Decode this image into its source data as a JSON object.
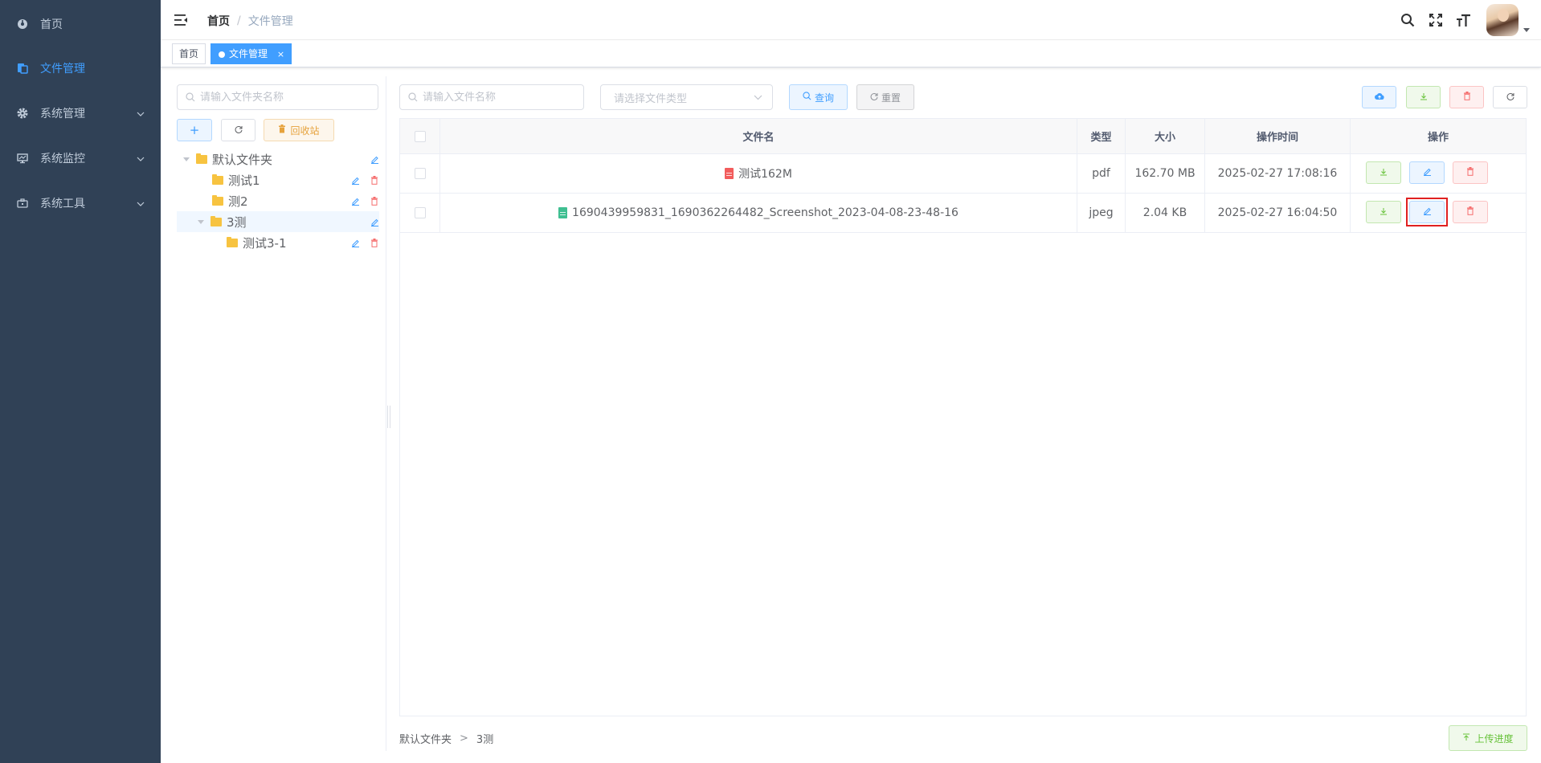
{
  "sidebar": {
    "items": [
      {
        "label": "首页",
        "icon": "dashboard-icon",
        "active": false
      },
      {
        "label": "文件管理",
        "icon": "files-icon",
        "active": true
      },
      {
        "label": "系统管理",
        "icon": "gear-icon",
        "active": false
      },
      {
        "label": "系统监控",
        "icon": "monitor-icon",
        "active": false
      },
      {
        "label": "系统工具",
        "icon": "toolbox-icon",
        "active": false
      }
    ]
  },
  "navbar": {
    "breadcrumb": {
      "home": "首页",
      "separator": "/",
      "current": "文件管理"
    }
  },
  "tags": [
    {
      "label": "首页"
    },
    {
      "label": "文件管理",
      "close": "×"
    }
  ],
  "tree": {
    "search_placeholder": "请输入文件夹名称",
    "add_label": "+",
    "recycle_label": "回收站",
    "nodes": [
      {
        "label": "默认文件夹"
      },
      {
        "label": "测试1"
      },
      {
        "label": "测2"
      },
      {
        "label": "3测"
      },
      {
        "label": "测试3-1"
      }
    ]
  },
  "toolbar": {
    "filename_placeholder": "请输入文件名称",
    "type_placeholder": "请选择文件类型",
    "query_label": "查询",
    "reset_label": "重置"
  },
  "table": {
    "headers": {
      "name": "文件名",
      "type": "类型",
      "size": "大小",
      "time": "操作时间",
      "ops": "操作"
    },
    "rows": [
      {
        "name": "测试162M",
        "type": "pdf",
        "size": "162.70 MB",
        "time": "2025-02-27 17:08:16",
        "file_icon": "pdf-file-icon"
      },
      {
        "name": "1690439959831_1690362264482_Screenshot_2023-04-08-23-48-16",
        "type": "jpeg",
        "size": "2.04 KB",
        "time": "2025-02-27 16:04:50",
        "file_icon": "image-file-icon"
      }
    ]
  },
  "footer": {
    "path": [
      "默认文件夹",
      "3测"
    ],
    "separator": ">",
    "upload_progress_label": "上传进度"
  },
  "colors": {
    "sidebar_bg": "#304156",
    "primary": "#409eff",
    "success": "#67c23a",
    "danger": "#f56c6c",
    "warning": "#e6a23c",
    "highlight": "#e02020"
  }
}
